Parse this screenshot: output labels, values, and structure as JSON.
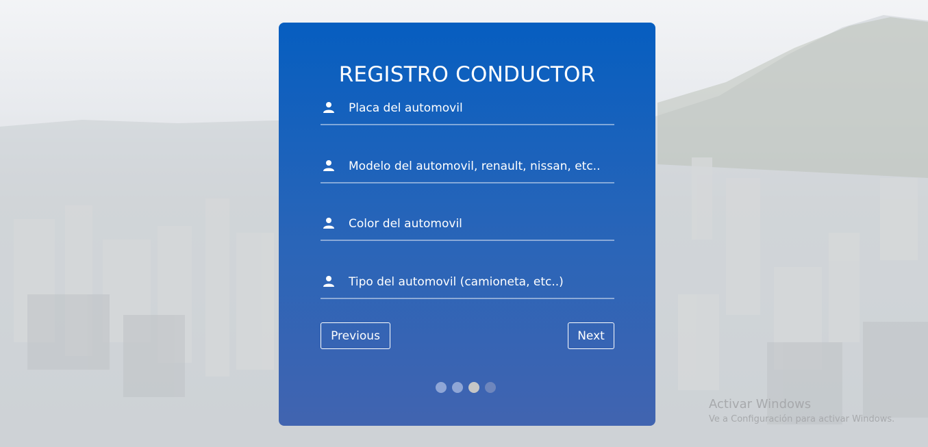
{
  "form": {
    "title": "REGISTRO CONDUCTOR",
    "fields": [
      {
        "placeholder": "Placa del automovil",
        "icon": "user-icon"
      },
      {
        "placeholder": "Modelo del automovil, renault, nissan, etc..",
        "icon": "user-icon"
      },
      {
        "placeholder": "Color del automovil",
        "icon": "user-icon"
      },
      {
        "placeholder": "Tipo del automovil (camioneta, etc..)",
        "icon": "user-icon"
      }
    ],
    "previous_label": "Previous",
    "next_label": "Next",
    "steps": {
      "total": 4,
      "current": 3,
      "colors": {
        "inactive": "#8fa6d6",
        "active": "#c6c6c6",
        "upcoming": "#6e86bd"
      }
    }
  },
  "watermark": {
    "line1": "Activar Windows",
    "line2": "Ve a Configuración para activar Windows."
  },
  "colors": {
    "card_top": "#065ec0",
    "card_bottom": "#4164b0",
    "text": "#ffffff"
  }
}
